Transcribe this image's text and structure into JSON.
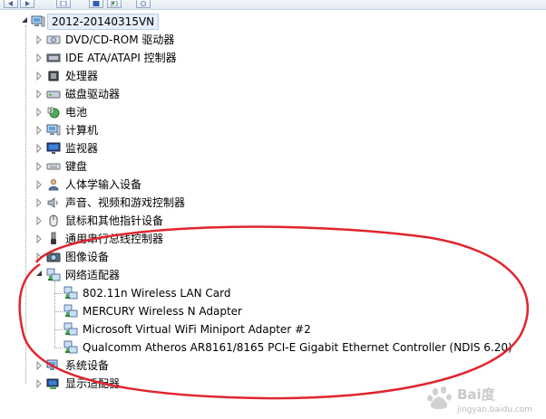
{
  "toolbar": {
    "buttons": [
      "back-icon",
      "forward-icon",
      "view-icon",
      "help-icon",
      "properties-icon",
      "scan-icon"
    ]
  },
  "tree": {
    "root": {
      "label": "2012-20140315VN",
      "icon": "computer-icon"
    },
    "categories": [
      {
        "label": "DVD/CD-ROM 驱动器",
        "icon": "dvd-drive-icon",
        "expanded": false
      },
      {
        "label": "IDE ATA/ATAPI 控制器",
        "icon": "ide-controller-icon",
        "expanded": false
      },
      {
        "label": "处理器",
        "icon": "processor-icon",
        "expanded": false
      },
      {
        "label": "磁盘驱动器",
        "icon": "disk-drive-icon",
        "expanded": false
      },
      {
        "label": "电池",
        "icon": "battery-icon",
        "expanded": false
      },
      {
        "label": "计算机",
        "icon": "computer-icon",
        "expanded": false
      },
      {
        "label": "监视器",
        "icon": "monitor-icon",
        "expanded": false
      },
      {
        "label": "键盘",
        "icon": "keyboard-icon",
        "expanded": false
      },
      {
        "label": "人体学输入设备",
        "icon": "hid-icon",
        "expanded": false
      },
      {
        "label": "声音、视频和游戏控制器",
        "icon": "sound-icon",
        "expanded": false
      },
      {
        "label": "鼠标和其他指针设备",
        "icon": "mouse-icon",
        "expanded": false
      },
      {
        "label": "通用串行总线控制器",
        "icon": "usb-icon",
        "expanded": false
      },
      {
        "label": "图像设备",
        "icon": "camera-icon",
        "expanded": false
      },
      {
        "label": "网络适配器",
        "icon": "network-adapter-icon",
        "expanded": true,
        "children": [
          {
            "label": "802.11n Wireless LAN Card",
            "icon": "network-adapter-icon"
          },
          {
            "label": "MERCURY Wireless N Adapter",
            "icon": "network-adapter-icon"
          },
          {
            "label": "Microsoft Virtual WiFi Miniport Adapter #2",
            "icon": "network-adapter-icon"
          },
          {
            "label": "Qualcomm Atheros AR8161/8165 PCI-E Gigabit Ethernet Controller (NDIS 6.20)",
            "icon": "network-adapter-icon"
          }
        ]
      },
      {
        "label": "系统设备",
        "icon": "system-device-icon",
        "expanded": false
      },
      {
        "label": "显示适配器",
        "icon": "display-adapter-icon",
        "expanded": false
      }
    ]
  },
  "watermark": {
    "text": "Bai度",
    "subtext": "jingyan.baidu.com"
  },
  "colors": {
    "annotation": "#e0252f",
    "selection_bg": "#e6eef9",
    "tree_line": "#a0a0a0"
  }
}
